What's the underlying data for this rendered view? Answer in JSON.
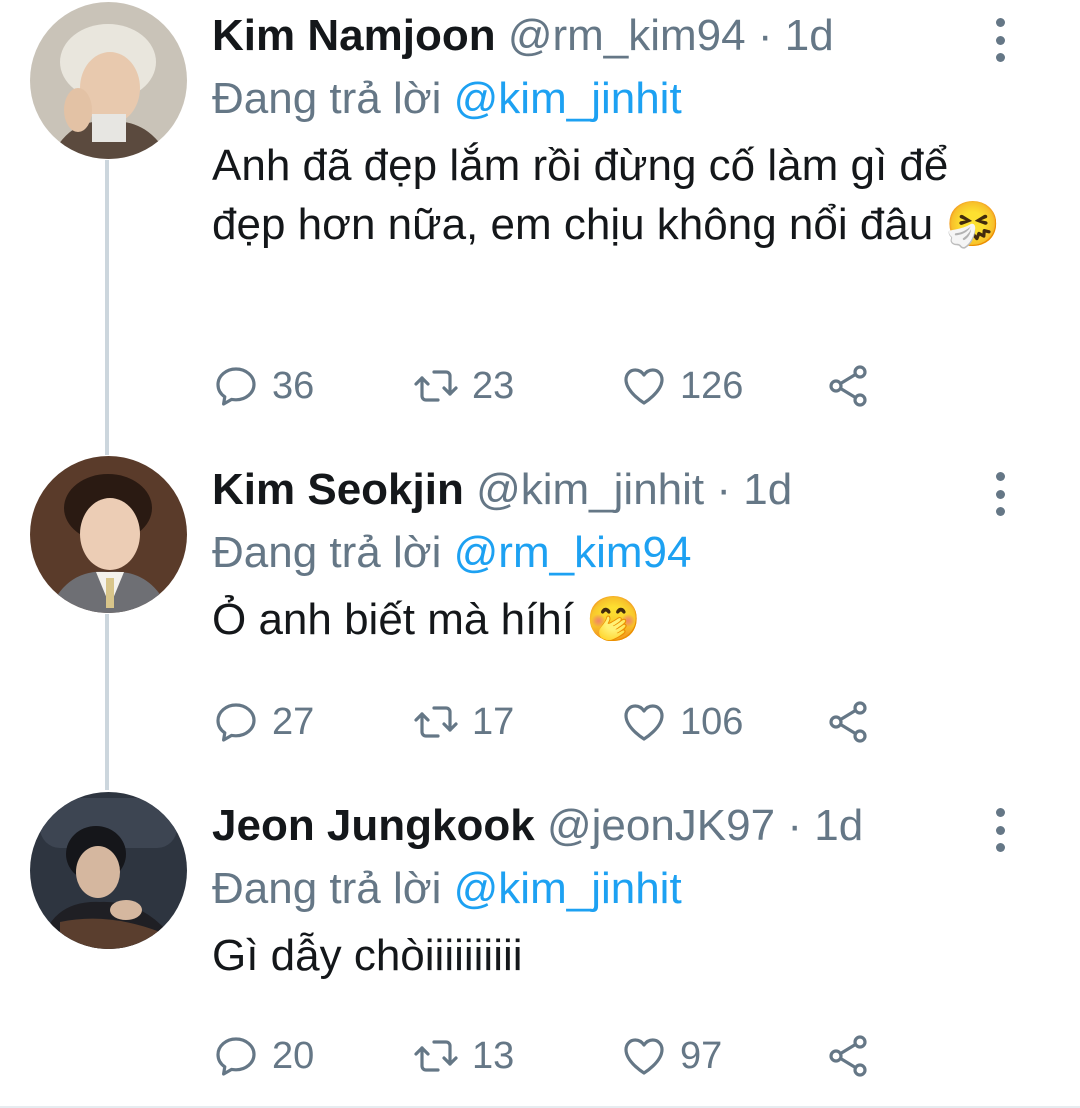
{
  "tweets": [
    {
      "name": "Kim Namjoon",
      "handle": "@rm_kim94",
      "separator": "·",
      "time": "1d",
      "replying_prefix": "Đang trả lời",
      "replying_to": "@kim_jinhit",
      "text": "Anh đã đẹp lắm rồi đừng cố làm gì để đẹp hơn nữa, em chịu không nổi đâu",
      "emoji": "🤧",
      "replies": "36",
      "retweets": "23",
      "likes": "126"
    },
    {
      "name": "Kim Seokjin",
      "handle": "@kim_jinhit",
      "separator": "·",
      "time": "1d",
      "replying_prefix": "Đang trả lời",
      "replying_to": "@rm_kim94",
      "text": "Ỏ anh biết mà híhí",
      "emoji": "🤭",
      "replies": "27",
      "retweets": "17",
      "likes": "106"
    },
    {
      "name": "Jeon Jungkook",
      "handle": "@jeonJK97",
      "separator": "·",
      "time": "1d",
      "replying_prefix": "Đang trả lời",
      "replying_to": "@kim_jinhit",
      "text": "Gì dẫy chòiiiiiiiiii",
      "emoji": "",
      "replies": "20",
      "retweets": "13",
      "likes": "97"
    }
  ],
  "icons": {
    "reply": "reply-icon",
    "retweet": "retweet-icon",
    "like": "heart-icon",
    "share": "share-icon",
    "more": "more-vertical-icon"
  },
  "colors": {
    "text": "#14171a",
    "secondary": "#657786",
    "link": "#1da1f2",
    "thread_line": "#ccd6dd"
  }
}
